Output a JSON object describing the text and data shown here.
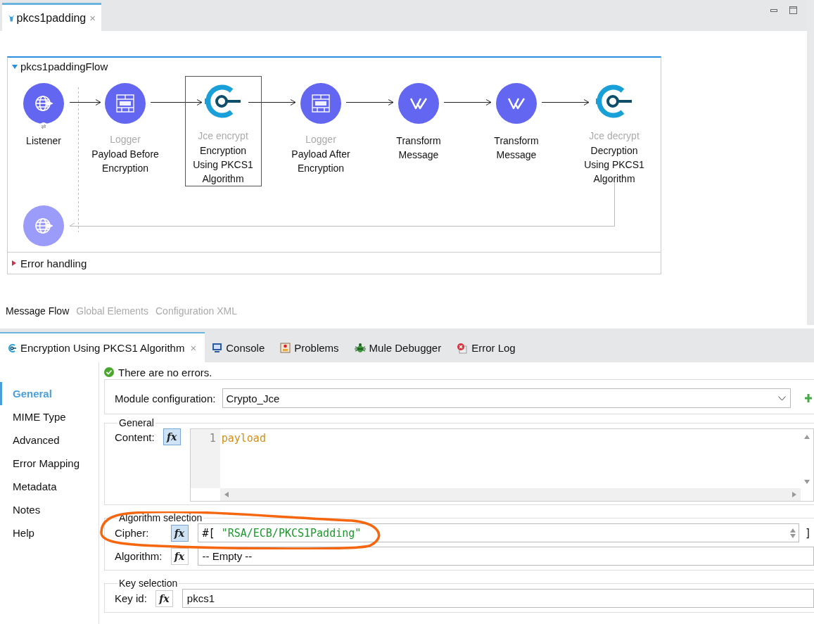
{
  "editor_tab": {
    "label": "pkcs1padding",
    "close": "×",
    "selected": true
  },
  "flow": {
    "name": "pkcs1paddingFlow",
    "expanded": true,
    "nodes": [
      {
        "kind": "listener",
        "name": "Listener",
        "selected": false
      },
      {
        "kind": "logger",
        "type_label": "Logger",
        "name": "Payload Before\nEncryption",
        "selected": false
      },
      {
        "kind": "jce",
        "type_label": "Jce encrypt",
        "name": "Encryption\nUsing PKCS1\nAlgorithm",
        "selected": true
      },
      {
        "kind": "logger",
        "type_label": "Logger",
        "name": "Payload After\nEncryption",
        "selected": false
      },
      {
        "kind": "transform",
        "name": "Transform\nMessage",
        "selected": false
      },
      {
        "kind": "transform",
        "name": "Transform\nMessage",
        "selected": false
      },
      {
        "kind": "jce",
        "type_label": "Jce decrypt",
        "name": "Decryption\nUsing PKCS1\nAlgorithm",
        "selected": false
      }
    ],
    "error_handling": {
      "label": "Error handling",
      "expanded": false
    }
  },
  "view_tabs": [
    {
      "label": "Message Flow",
      "selected": true
    },
    {
      "label": "Global Elements",
      "selected": false
    },
    {
      "label": "Configuration XML",
      "selected": false
    }
  ],
  "panel_tabs": [
    {
      "kind": "properties",
      "label": "Encryption Using PKCS1 Algorithm",
      "close": "×",
      "selected": true
    },
    {
      "kind": "console",
      "label": "Console",
      "selected": false
    },
    {
      "kind": "problems",
      "label": "Problems",
      "selected": false
    },
    {
      "kind": "debugger",
      "label": "Mule Debugger",
      "selected": false
    },
    {
      "kind": "error_log",
      "label": "Error Log",
      "selected": false
    }
  ],
  "status": "There are no errors.",
  "sidebar": [
    {
      "label": "General",
      "selected": true
    },
    {
      "label": "MIME Type",
      "selected": false
    },
    {
      "label": "Advanced",
      "selected": false
    },
    {
      "label": "Error Mapping",
      "selected": false
    },
    {
      "label": "Metadata",
      "selected": false
    },
    {
      "label": "Notes",
      "selected": false
    },
    {
      "label": "Help",
      "selected": false
    }
  ],
  "module_configuration": {
    "label": "Module configuration:",
    "value": "Crypto_Jce"
  },
  "sections": [
    {
      "title": "General",
      "fields": [
        {
          "kind": "code",
          "label": "Content:",
          "fx": "fx",
          "fx_active": true,
          "line": "1",
          "value": "payload"
        }
      ]
    },
    {
      "title": "Algorithm selection",
      "fields": [
        {
          "kind": "expression",
          "label": "Cipher:",
          "fx": "fx",
          "fx_active": true,
          "prefix": "#[",
          "value": "\"RSA/ECB/PKCS1Padding\"",
          "suffix": "]"
        },
        {
          "kind": "text",
          "label": "Algorithm:",
          "fx": "fx",
          "fx_active": false,
          "value": "-- Empty --"
        }
      ]
    },
    {
      "title": "Key selection",
      "fields": [
        {
          "kind": "text",
          "label": "Key id:",
          "fx": "fx",
          "fx_active": false,
          "value": "pkcs1"
        }
      ]
    }
  ]
}
